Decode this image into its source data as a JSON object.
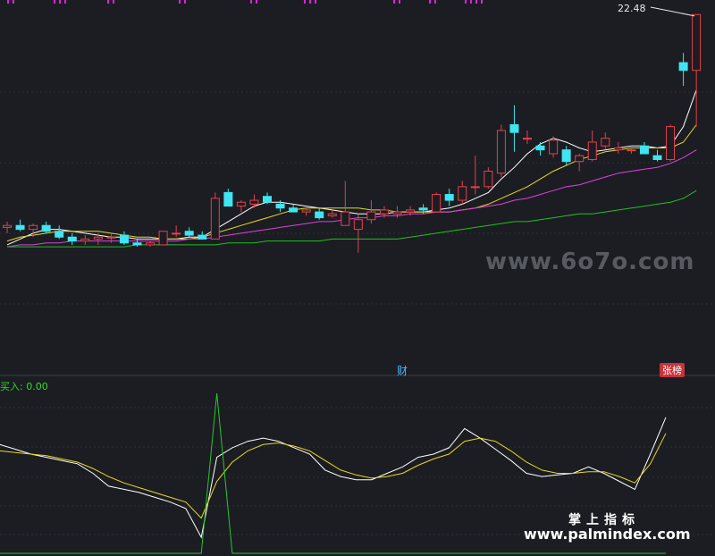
{
  "chart_data": [
    {
      "type": "candlestick",
      "title": "",
      "overlays": [
        "MA5",
        "MA10",
        "MA20",
        "MA60"
      ],
      "price_label": "22.48",
      "ylim": [
        7,
        23
      ],
      "candles": [
        {
          "o": 11.5,
          "h": 11.8,
          "l": 11.2,
          "c": 11.6
        },
        {
          "o": 11.6,
          "h": 11.9,
          "l": 11.3,
          "c": 11.4
        },
        {
          "o": 11.4,
          "h": 11.7,
          "l": 11.0,
          "c": 11.6
        },
        {
          "o": 11.6,
          "h": 11.8,
          "l": 11.2,
          "c": 11.3
        },
        {
          "o": 11.3,
          "h": 11.6,
          "l": 10.9,
          "c": 11.0
        },
        {
          "o": 11.0,
          "h": 11.2,
          "l": 10.6,
          "c": 10.8
        },
        {
          "o": 10.8,
          "h": 11.1,
          "l": 10.6,
          "c": 10.9
        },
        {
          "o": 10.9,
          "h": 11.2,
          "l": 10.6,
          "c": 11.0
        },
        {
          "o": 11.0,
          "h": 11.2,
          "l": 10.7,
          "c": 11.0
        },
        {
          "o": 11.1,
          "h": 11.3,
          "l": 10.6,
          "c": 10.7
        },
        {
          "o": 10.7,
          "h": 10.9,
          "l": 10.5,
          "c": 10.6
        },
        {
          "o": 10.6,
          "h": 10.8,
          "l": 10.5,
          "c": 10.7
        },
        {
          "o": 10.6,
          "h": 11.3,
          "l": 10.6,
          "c": 11.3
        },
        {
          "o": 11.2,
          "h": 11.6,
          "l": 11.0,
          "c": 11.2
        },
        {
          "o": 11.3,
          "h": 11.5,
          "l": 11.0,
          "c": 11.1
        },
        {
          "o": 11.1,
          "h": 11.3,
          "l": 10.9,
          "c": 10.9
        },
        {
          "o": 10.9,
          "h": 13.3,
          "l": 10.9,
          "c": 13.0
        },
        {
          "o": 13.3,
          "h": 13.5,
          "l": 12.6,
          "c": 12.6
        },
        {
          "o": 12.6,
          "h": 12.9,
          "l": 12.3,
          "c": 12.8
        },
        {
          "o": 12.7,
          "h": 13.2,
          "l": 12.5,
          "c": 12.9
        },
        {
          "o": 13.1,
          "h": 13.3,
          "l": 12.7,
          "c": 12.8
        },
        {
          "o": 12.7,
          "h": 12.9,
          "l": 12.3,
          "c": 12.5
        },
        {
          "o": 12.5,
          "h": 12.7,
          "l": 12.3,
          "c": 12.3
        },
        {
          "o": 12.3,
          "h": 12.5,
          "l": 12.1,
          "c": 12.4
        },
        {
          "o": 12.3,
          "h": 12.5,
          "l": 11.9,
          "c": 12.0
        },
        {
          "o": 12.1,
          "h": 12.4,
          "l": 12.0,
          "c": 12.2
        },
        {
          "o": 11.6,
          "h": 13.9,
          "l": 11.6,
          "c": 12.3
        },
        {
          "o": 11.4,
          "h": 12.2,
          "l": 10.2,
          "c": 11.9
        },
        {
          "o": 11.9,
          "h": 12.9,
          "l": 11.7,
          "c": 12.3
        },
        {
          "o": 12.2,
          "h": 12.6,
          "l": 12.0,
          "c": 12.4
        },
        {
          "o": 12.2,
          "h": 12.6,
          "l": 12.0,
          "c": 12.3
        },
        {
          "o": 12.3,
          "h": 12.6,
          "l": 12.1,
          "c": 12.4
        },
        {
          "o": 12.5,
          "h": 12.7,
          "l": 12.2,
          "c": 12.4
        },
        {
          "o": 12.3,
          "h": 13.3,
          "l": 12.3,
          "c": 13.2
        },
        {
          "o": 13.2,
          "h": 13.5,
          "l": 12.6,
          "c": 12.9
        },
        {
          "o": 12.9,
          "h": 13.9,
          "l": 12.7,
          "c": 13.6
        },
        {
          "o": 13.6,
          "h": 15.2,
          "l": 13.2,
          "c": 13.6
        },
        {
          "o": 13.6,
          "h": 14.6,
          "l": 13.5,
          "c": 14.4
        },
        {
          "o": 14.3,
          "h": 16.8,
          "l": 14.1,
          "c": 16.5
        },
        {
          "o": 16.8,
          "h": 17.8,
          "l": 15.4,
          "c": 16.4
        },
        {
          "o": 16.1,
          "h": 16.5,
          "l": 15.8,
          "c": 16.1
        },
        {
          "o": 15.7,
          "h": 15.9,
          "l": 15.2,
          "c": 15.5
        },
        {
          "o": 15.3,
          "h": 16.2,
          "l": 15.1,
          "c": 16.0
        },
        {
          "o": 15.5,
          "h": 15.7,
          "l": 14.7,
          "c": 14.9
        },
        {
          "o": 14.9,
          "h": 15.3,
          "l": 14.4,
          "c": 15.2
        },
        {
          "o": 15.0,
          "h": 16.5,
          "l": 14.9,
          "c": 15.9
        },
        {
          "o": 15.7,
          "h": 16.4,
          "l": 15.5,
          "c": 16.1
        },
        {
          "o": 15.5,
          "h": 15.9,
          "l": 15.3,
          "c": 15.6
        },
        {
          "o": 15.5,
          "h": 15.7,
          "l": 15.3,
          "c": 15.5
        },
        {
          "o": 15.7,
          "h": 15.9,
          "l": 15.3,
          "c": 15.3
        },
        {
          "o": 15.2,
          "h": 15.5,
          "l": 14.9,
          "c": 15.0
        },
        {
          "o": 15.0,
          "h": 16.8,
          "l": 14.9,
          "c": 16.7
        },
        {
          "o": 20.0,
          "h": 20.5,
          "l": 18.8,
          "c": 19.6
        },
        {
          "o": 19.6,
          "h": 22.5,
          "l": 16.7,
          "c": 22.48
        }
      ],
      "ma": {
        "MA5": [
          10.6,
          10.9,
          11.2,
          11.4,
          11.4,
          11.3,
          11.2,
          11.1,
          11.0,
          11.0,
          10.9,
          10.9,
          10.9,
          10.9,
          11.0,
          11.0,
          11.4,
          11.8,
          12.2,
          12.6,
          12.8,
          12.8,
          12.7,
          12.6,
          12.5,
          12.4,
          12.3,
          12.2,
          12.2,
          12.2,
          12.3,
          12.3,
          12.3,
          12.4,
          12.5,
          12.7,
          13.0,
          13.3,
          14.0,
          14.6,
          15.3,
          15.8,
          16.1,
          15.9,
          15.6,
          15.4,
          15.5,
          15.6,
          15.7,
          15.7,
          15.6,
          15.7,
          16.7,
          18.6
        ],
        "MA10": [
          10.8,
          11.0,
          11.1,
          11.2,
          11.3,
          11.3,
          11.3,
          11.3,
          11.2,
          11.1,
          11.0,
          11.0,
          10.9,
          10.9,
          10.9,
          11.0,
          11.2,
          11.4,
          11.6,
          11.8,
          12.0,
          12.2,
          12.4,
          12.5,
          12.5,
          12.5,
          12.5,
          12.5,
          12.4,
          12.4,
          12.3,
          12.3,
          12.3,
          12.3,
          12.3,
          12.4,
          12.5,
          12.7,
          13.0,
          13.3,
          13.6,
          14.0,
          14.4,
          14.7,
          15.0,
          15.2,
          15.4,
          15.5,
          15.6,
          15.6,
          15.6,
          15.6,
          15.9,
          16.8
        ],
        "MA20": [
          10.5,
          10.6,
          10.6,
          10.7,
          10.7,
          10.8,
          10.8,
          10.8,
          10.8,
          10.8,
          10.8,
          10.8,
          10.8,
          10.8,
          10.9,
          10.9,
          11.0,
          11.1,
          11.2,
          11.3,
          11.4,
          11.5,
          11.6,
          11.7,
          11.8,
          11.8,
          11.9,
          12.0,
          12.0,
          12.1,
          12.1,
          12.2,
          12.2,
          12.3,
          12.3,
          12.4,
          12.5,
          12.6,
          12.7,
          12.9,
          13.0,
          13.2,
          13.4,
          13.6,
          13.7,
          13.9,
          14.1,
          14.3,
          14.4,
          14.5,
          14.6,
          14.8,
          15.1,
          15.5
        ],
        "MA60": [
          10.5,
          10.5,
          10.5,
          10.5,
          10.5,
          10.5,
          10.5,
          10.5,
          10.5,
          10.5,
          10.6,
          10.6,
          10.6,
          10.6,
          10.6,
          10.6,
          10.6,
          10.7,
          10.7,
          10.7,
          10.8,
          10.8,
          10.8,
          10.8,
          10.8,
          10.9,
          10.9,
          10.9,
          10.9,
          10.9,
          10.9,
          11.0,
          11.1,
          11.2,
          11.3,
          11.4,
          11.5,
          11.6,
          11.7,
          11.8,
          11.8,
          11.9,
          12.0,
          12.1,
          12.2,
          12.2,
          12.3,
          12.4,
          12.5,
          12.6,
          12.7,
          12.8,
          13.0,
          13.4
        ]
      }
    },
    {
      "type": "line",
      "label": "买入: 0.00",
      "ylim": [
        0,
        100
      ],
      "series": [
        {
          "color": "#ffffff",
          "values": [
            68,
            65,
            62,
            60,
            58,
            56,
            50,
            42,
            40,
            38,
            35,
            32,
            28,
            10,
            60,
            66,
            70,
            72,
            70,
            66,
            62,
            52,
            48,
            46,
            46,
            50,
            54,
            60,
            62,
            66,
            78,
            72,
            65,
            58,
            50,
            48,
            49,
            50,
            54,
            50,
            45,
            40,
            62,
            85
          ]
        },
        {
          "color": "#e8d820",
          "values": [
            64,
            63,
            62,
            61,
            59,
            57,
            53,
            48,
            44,
            41,
            38,
            35,
            32,
            22,
            45,
            57,
            64,
            68,
            69,
            67,
            64,
            58,
            52,
            49,
            47,
            48,
            50,
            55,
            59,
            62,
            70,
            72,
            70,
            64,
            57,
            52,
            50,
            50,
            51,
            51,
            48,
            44,
            56,
            75
          ]
        },
        {
          "color": "#28c828",
          "values": [
            0,
            0,
            0,
            0,
            0,
            0,
            0,
            0,
            0,
            0,
            0,
            0,
            0,
            0,
            100,
            0,
            0,
            0,
            0,
            0,
            0,
            0,
            0,
            0,
            0,
            0,
            0,
            0,
            0,
            0,
            0,
            0,
            0,
            0,
            0,
            0,
            0,
            0,
            0,
            0,
            0,
            0,
            0,
            0
          ]
        }
      ]
    }
  ],
  "badges": {
    "cai": "财",
    "zhangbang": "张榜"
  },
  "watermarks": {
    "site": "www.6o7o.com",
    "cn": "掌上指标",
    "url": "www.palmindex.com"
  },
  "colors": {
    "up": "#e8404a",
    "down": "#3fe5f0",
    "ma5": "#ffffff",
    "ma10": "#e8d820",
    "ma20": "#e040e0",
    "ma60": "#20c020",
    "bg": "#1b1d22",
    "grid": "#2c3038"
  }
}
